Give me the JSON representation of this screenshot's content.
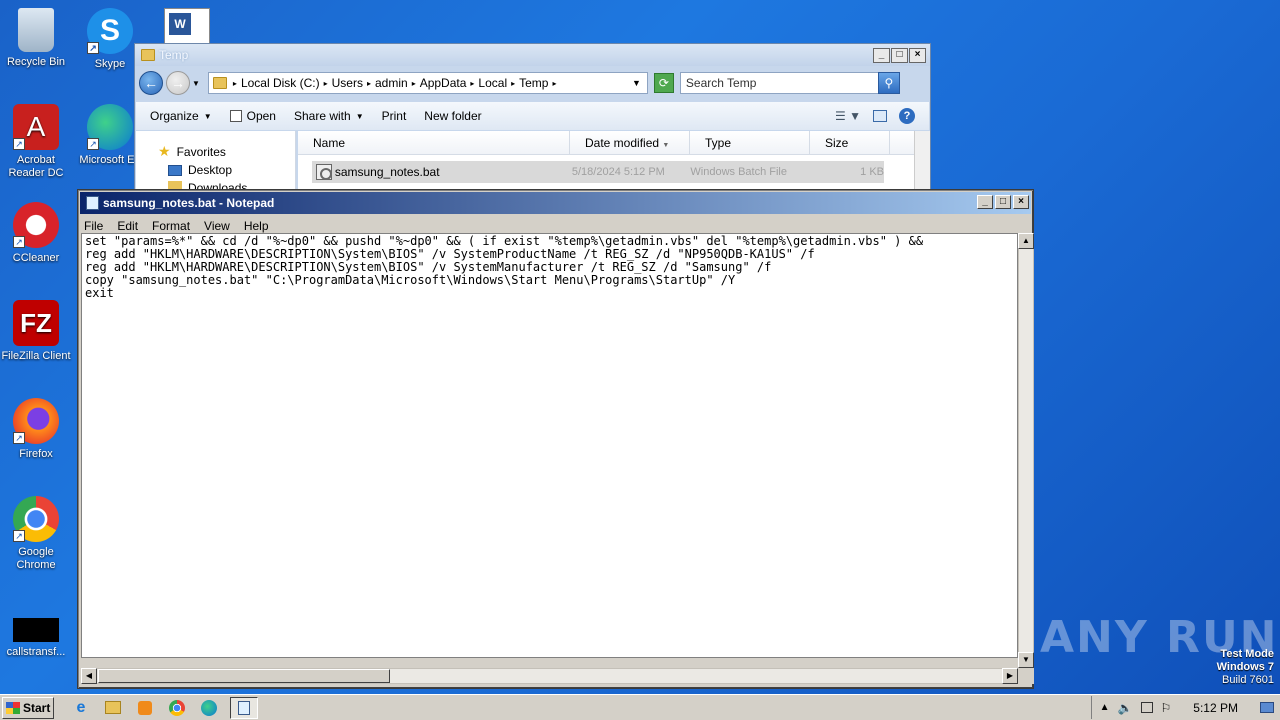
{
  "desktop": {
    "icons": [
      {
        "label": "Recycle Bin"
      },
      {
        "label": "Skype"
      },
      {
        "label": "Acrobat Reader DC"
      },
      {
        "label": "Microsoft Ed"
      },
      {
        "label": "CCleaner"
      },
      {
        "label": "FileZilla Client"
      },
      {
        "label": "Firefox"
      },
      {
        "label": "Google Chrome"
      },
      {
        "label": "callstransf..."
      }
    ]
  },
  "explorer": {
    "title": "Temp",
    "breadcrumb": [
      "Local Disk (C:)",
      "Users",
      "admin",
      "AppData",
      "Local",
      "Temp"
    ],
    "search_placeholder": "Search Temp",
    "toolbar": {
      "organize": "Organize",
      "open": "Open",
      "share_with": "Share with",
      "print": "Print",
      "new_folder": "New folder"
    },
    "nav": {
      "favorites": "Favorites",
      "desktop": "Desktop",
      "downloads": "Downloads"
    },
    "columns": {
      "name": "Name",
      "date_modified": "Date modified",
      "type": "Type",
      "size": "Size"
    },
    "files": [
      {
        "name": "samsung_notes.bat",
        "date": "5/18/2024 5:12 PM",
        "type": "Windows Batch File",
        "size": "1 KB"
      }
    ]
  },
  "notepad": {
    "title": "samsung_notes.bat - Notepad",
    "menu": {
      "file": "File",
      "edit": "Edit",
      "format": "Format",
      "view": "View",
      "help": "Help"
    },
    "lines": [
      "set \"params=%*\" && cd /d \"%~dp0\" && pushd \"%~dp0\" && ( if exist \"%temp%\\getadmin.vbs\" del \"%temp%\\getadmin.vbs\" ) &&",
      "reg add \"HKLM\\HARDWARE\\DESCRIPTION\\System\\BIOS\" /v SystemProductName /t REG_SZ /d \"NP950QDB-KA1US\" /f",
      "reg add \"HKLM\\HARDWARE\\DESCRIPTION\\System\\BIOS\" /v SystemManufacturer /t REG_SZ /d \"Samsung\" /f",
      "copy \"samsung_notes.bat\" \"C:\\ProgramData\\Microsoft\\Windows\\Start Menu\\Programs\\StartUp\" /Y",
      "exit"
    ]
  },
  "watermark": {
    "brand": "ANY RUN",
    "test_mode": "Test Mode",
    "os": "Windows 7",
    "build": "Build 7601"
  },
  "taskbar": {
    "start": "Start",
    "clock": "5:12 PM"
  }
}
